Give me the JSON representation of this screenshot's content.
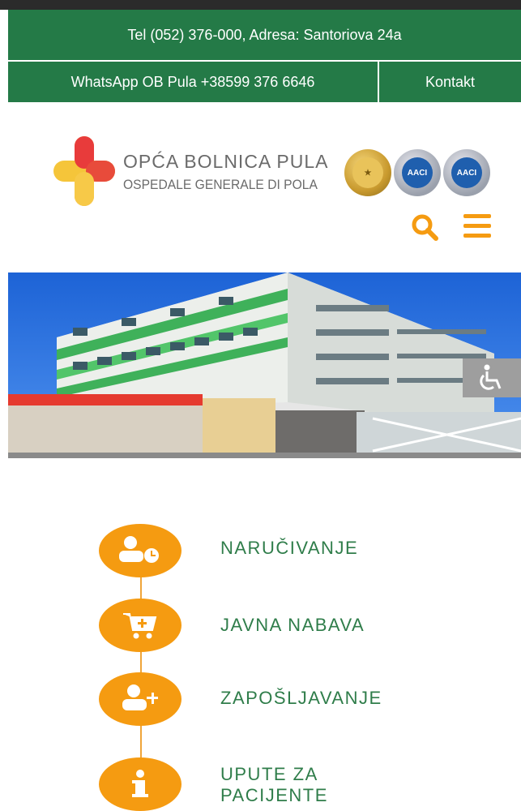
{
  "header": {
    "contact_line": "Tel (052) 376-000, Adresa: Santoriova 24a",
    "whatsapp": "WhatsApp OB Pula +38599 376 6646",
    "kontakt": "Kontakt"
  },
  "logo": {
    "title": "OPĆA BOLNICA PULA",
    "subtitle": "OSPEDALE GENERALE DI POLA",
    "badges": [
      "gold-certificate-badge",
      "AACI",
      "AACI"
    ]
  },
  "colors": {
    "green": "#247a47",
    "orange": "#f59b11",
    "link_green": "#2f7d4a"
  },
  "nav_items": [
    {
      "label": "NARUČIVANJE",
      "icon": "appointment-icon"
    },
    {
      "label": "JAVNA NABAVA",
      "icon": "cart-icon"
    },
    {
      "label": "ZAPOŠLJAVANJE",
      "icon": "add-user-icon"
    },
    {
      "label": "UPUTE ZA PACIJENTE",
      "icon": "info-icon"
    }
  ]
}
